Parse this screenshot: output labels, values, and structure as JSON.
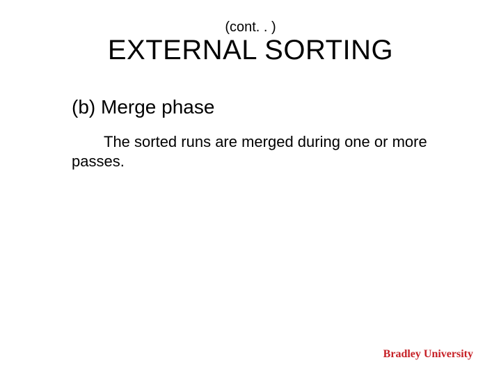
{
  "header": {
    "cont": "(cont. . )",
    "title": "EXTERNAL SORTING"
  },
  "content": {
    "subheading": "(b) Merge phase",
    "body": "The sorted runs are merged during one or more passes."
  },
  "footer": {
    "institution": "Bradley University"
  }
}
